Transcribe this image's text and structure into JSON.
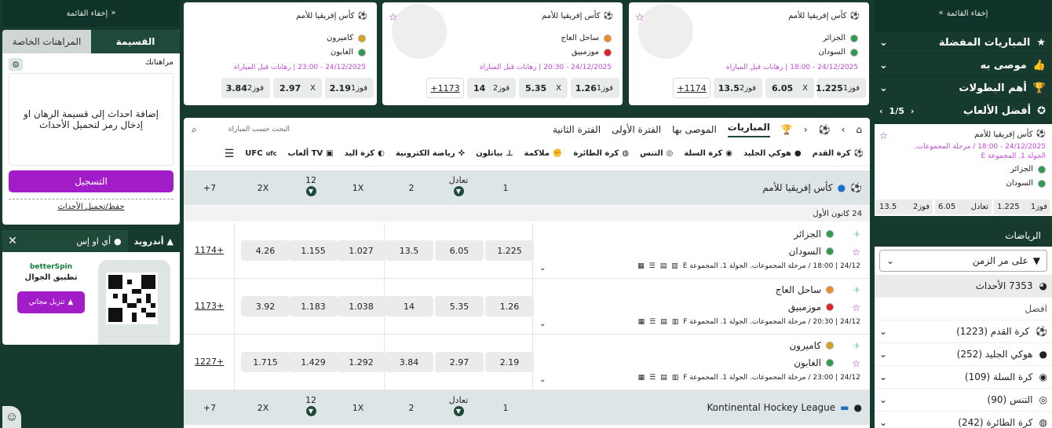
{
  "left": {
    "hide_menu": "إخفاء القائمة",
    "slip_tabs": [
      "القسيمة",
      "المراهنات الخاصة"
    ],
    "my_bets": "مراهناتك",
    "slip_hint": "إضافة احداث إلى قسيمة الرهان او إدخال رمز لتحميل الأحداث",
    "register": "التسجيل",
    "save_load": "حفظ/تحميل الأحداث",
    "app_tabs": [
      "أندرويد",
      "أي او إس"
    ],
    "brand": "betterSpin",
    "app_title": "تطبيق الجوال",
    "download": "تنزيل مجاني"
  },
  "cards": [
    {
      "league": "كأس إفريقيا للأمم",
      "team1": "الجزائر",
      "team2": "السودان",
      "dt": "24/12/2025 - 18:00 | رهانات قبل المباراة",
      "odds": [
        {
          "l": "فوز1",
          "v": "1.225"
        },
        {
          "l": "X",
          "v": "6.05"
        },
        {
          "l": "فوز2",
          "v": "13.5"
        }
      ],
      "more": "1174+",
      "c1": "#2e9b4f",
      "c2": "#2e9b4f"
    },
    {
      "league": "كأس إفريقيا للأمم",
      "team1": "ساحل العاج",
      "team2": "موزمبيق",
      "dt": "24/12/2025 - 20:30 | رهانات قبل المباراة",
      "odds": [
        {
          "l": "فوز1",
          "v": "1.26"
        },
        {
          "l": "X",
          "v": "5.35"
        },
        {
          "l": "فوز2",
          "v": "14"
        }
      ],
      "more": "1173+",
      "c1": "#f08a24",
      "c2": "#d22"
    },
    {
      "league": "كأس إفريقيا للأمم",
      "team1": "كاميرون",
      "team2": "الغابون",
      "dt": "24/12/2025 - 23:00 | رهانات قبل المباراة",
      "odds": [
        {
          "l": "فوز1",
          "v": "2.19"
        },
        {
          "l": "X",
          "v": "2.97"
        },
        {
          "l": "فوز2",
          "v": "3.84"
        }
      ],
      "more": "",
      "c1": "#d9a21c",
      "c2": "#2e9b4f"
    }
  ],
  "main": {
    "tabs": [
      "المباريات",
      "الموصى بها",
      "الفترة الأولى",
      "الفترة الثانية"
    ],
    "search_placeholder": "البحث حسب المباراة",
    "sports": [
      "كرة القدم",
      "هوكي الجليد",
      "كرة السلة",
      "التنس",
      "كرة الطائرة",
      "ملاكمة",
      "بياتلون",
      "رياضة الكترونية",
      "كرة اليد",
      "TV ألعاب",
      "UFC"
    ],
    "league1": "كأس إفريقيا للأمم",
    "league2": "Kontinental Hockey League",
    "cols": [
      "1",
      "تعادل",
      "2",
      "1X",
      "12",
      "2X",
      "7+"
    ],
    "date": "24 كانون الأول",
    "matches": [
      {
        "t1": "الجزائر",
        "t2": "السودان",
        "meta": "24/12 | 18:00 / مرحلة المجموعات. الجولة 1. المجموعة E",
        "odds": [
          "1.225",
          "6.05",
          "13.5",
          "1.027",
          "1.155",
          "4.26"
        ],
        "more": "1174+",
        "c1": "#2e9b4f",
        "c2": "#2e9b4f"
      },
      {
        "t1": "ساحل العاج",
        "t2": "موزمبيق",
        "meta": "24/12 | 20:30 / مرحلة المجموعات. الجولة 1. المجموعة F",
        "odds": [
          "1.26",
          "5.35",
          "14",
          "1.038",
          "1.183",
          "3.92"
        ],
        "more": "1173+",
        "c1": "#f08a24",
        "c2": "#d22"
      },
      {
        "t1": "كاميرون",
        "t2": "الغابون",
        "meta": "24/12 | 23:00 / مرحلة المجموعات. الجولة 1. المجموعة F",
        "odds": [
          "2.19",
          "2.97",
          "3.84",
          "1.292",
          "1.429",
          "1.715"
        ],
        "more": "1227+",
        "c1": "#d9a21c",
        "c2": "#2e9b4f"
      }
    ]
  },
  "right": {
    "hide_menu": "إخفاء القائمة",
    "items": [
      "المباريات المفضلة",
      "موصى به",
      "أهم البطولات",
      "أفضل الألعاب"
    ],
    "pager": "1/5",
    "top": {
      "league": "كأس إفريقيا للأمم",
      "dt": "24/12/2025 - 18:00 / مرحلة المجموعات.",
      "round": "الجولة 1. المجموعة E",
      "t1": "الجزائر",
      "t2": "السودان",
      "odds": [
        {
          "l": "فوز1",
          "v": "1.225"
        },
        {
          "l": "تعادل",
          "v": "6.05"
        },
        {
          "l": "فوز2",
          "v": "13.5"
        }
      ]
    },
    "sports_title": "الرياضات",
    "sort": "على مر الزمن",
    "events": "7353 الأحداث",
    "best": "افضل",
    "sport_list": [
      "كرة القدم (1223)",
      "هوكي الجليد (252)",
      "كرة السلة (109)",
      "التنس (90)",
      "كرة الطائرة (242)"
    ]
  }
}
